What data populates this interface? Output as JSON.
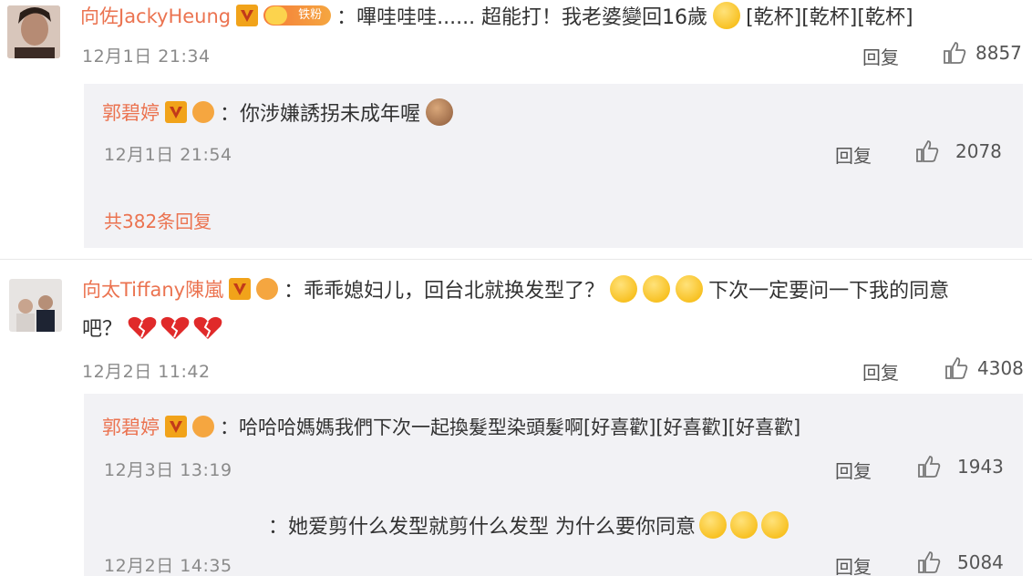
{
  "comments": [
    {
      "user": "向佐JackyHeung",
      "fan_badge": "铁粉",
      "text": "：嗶哇哇哇...... 超能打！我老婆變回16歲",
      "tail": "[乾杯][乾杯][乾杯]",
      "time": "12月1日 21:34",
      "reply_label": "回复",
      "likes": "8857",
      "replies": [
        {
          "user": "郭碧婷",
          "text": "：你涉嫌誘拐未成年喔",
          "time": "12月1日 21:54",
          "reply_label": "回复",
          "likes": "2078"
        }
      ],
      "more_replies": "共382条回复"
    },
    {
      "user": "向太Tiffany陳嵐",
      "text": "：乖乖媳妇儿，回台北就换发型了？",
      "text2": "下次一定要问一下我的同意",
      "line2": "吧？",
      "time": "12月2日 11:42",
      "reply_label": "回复",
      "likes": "4308",
      "replies": [
        {
          "user": "郭碧婷",
          "text": "：哈哈哈媽媽我們下次一起換髮型染頭髮啊[好喜歡][好喜歡][好喜歡]",
          "time": "12月3日 13:19",
          "reply_label": "回复",
          "likes": "1943"
        },
        {
          "user": "",
          "text": "：她爱剪什么发型就剪什么发型 为什么要你同意",
          "time": "12月2日 14:35",
          "reply_label": "回复",
          "likes": "5084"
        }
      ]
    }
  ],
  "colors": {
    "name": "#eb7350",
    "sub_bg": "#f2f2f5",
    "v_badge": "#f1a31a"
  }
}
